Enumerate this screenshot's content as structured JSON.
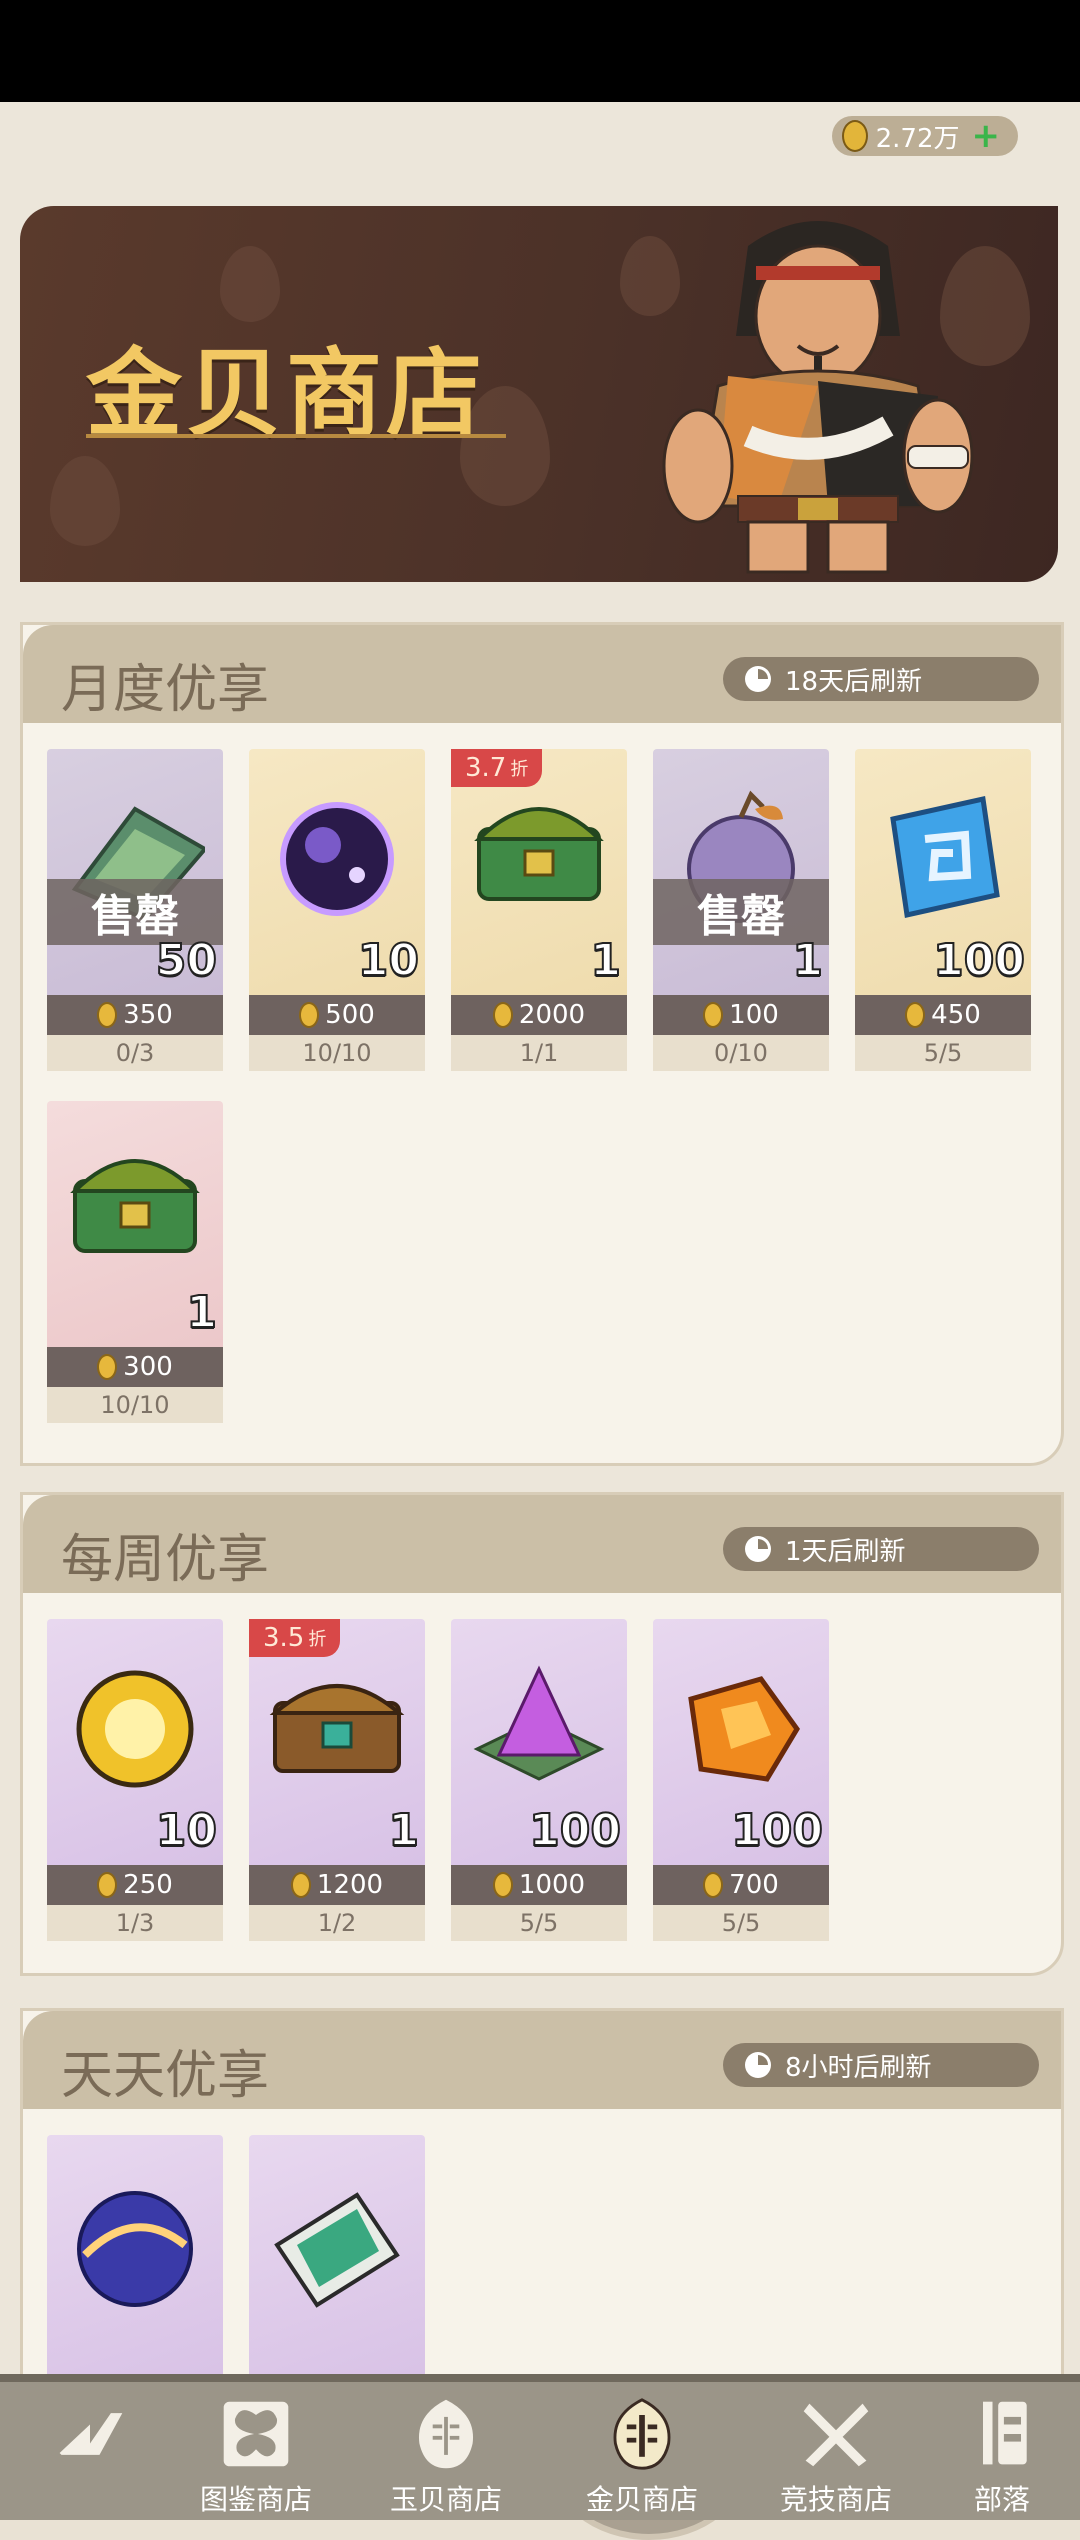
{
  "currency": {
    "amount": "2.72万",
    "icon": "gold-shell-coin-icon",
    "add_icon": "plus-icon"
  },
  "banner": {
    "title": "金贝商店",
    "character": "tribal-chief-character"
  },
  "sections": [
    {
      "title": "月度优享",
      "refresh": "18天后刷新",
      "items": [
        {
          "icon": "jade-shard-icon",
          "bg": "grey",
          "qty": "50",
          "price": "350",
          "limit": "0/3",
          "soldout": "售罄"
        },
        {
          "icon": "purple-orb-icon",
          "bg": "yellow",
          "qty": "10",
          "price": "500",
          "limit": "10/10"
        },
        {
          "icon": "jade-chest-icon",
          "bg": "yellow",
          "qty": "1",
          "price": "2000",
          "limit": "1/1",
          "discount": "3.7",
          "discount_unit": "折"
        },
        {
          "icon": "purple-fruit-icon",
          "bg": "grey",
          "qty": "1",
          "price": "100",
          "limit": "0/10",
          "soldout": "售罄"
        },
        {
          "icon": "blue-rune-icon",
          "bg": "yellow",
          "qty": "100",
          "price": "450",
          "limit": "5/5"
        },
        {
          "icon": "jade-chest-icon",
          "bg": "pink",
          "qty": "1",
          "price": "300",
          "limit": "10/10"
        }
      ]
    },
    {
      "title": "每周优享",
      "refresh": "1天后刷新",
      "items": [
        {
          "icon": "golden-orb-icon",
          "bg": "purple",
          "qty": "10",
          "price": "250",
          "limit": "1/3"
        },
        {
          "icon": "wooden-chest-icon",
          "bg": "purple",
          "qty": "1",
          "price": "1200",
          "limit": "1/2",
          "discount": "3.5",
          "discount_unit": "折"
        },
        {
          "icon": "purple-crystal-icon",
          "bg": "purple",
          "qty": "100",
          "price": "1000",
          "limit": "5/5"
        },
        {
          "icon": "amber-ore-icon",
          "bg": "purple",
          "qty": "100",
          "price": "700",
          "limit": "5/5"
        }
      ]
    },
    {
      "title": "天天优享",
      "refresh": "8小时后刷新",
      "items": [
        {
          "icon": "cosmic-orb-icon",
          "bg": "purple"
        },
        {
          "icon": "green-ticket-icon",
          "bg": "purple"
        }
      ]
    }
  ],
  "nav": [
    {
      "label": "",
      "icon": "back-logo-icon"
    },
    {
      "label": "图鉴商店",
      "icon": "butterfly-book-icon"
    },
    {
      "label": "玉贝商店",
      "icon": "jade-shell-icon"
    },
    {
      "label": "金贝商店",
      "icon": "gold-shell-icon",
      "active": true
    },
    {
      "label": "竞技商店",
      "icon": "crossed-swords-icon"
    },
    {
      "label": "部落",
      "icon": "tribe-totem-icon"
    }
  ]
}
